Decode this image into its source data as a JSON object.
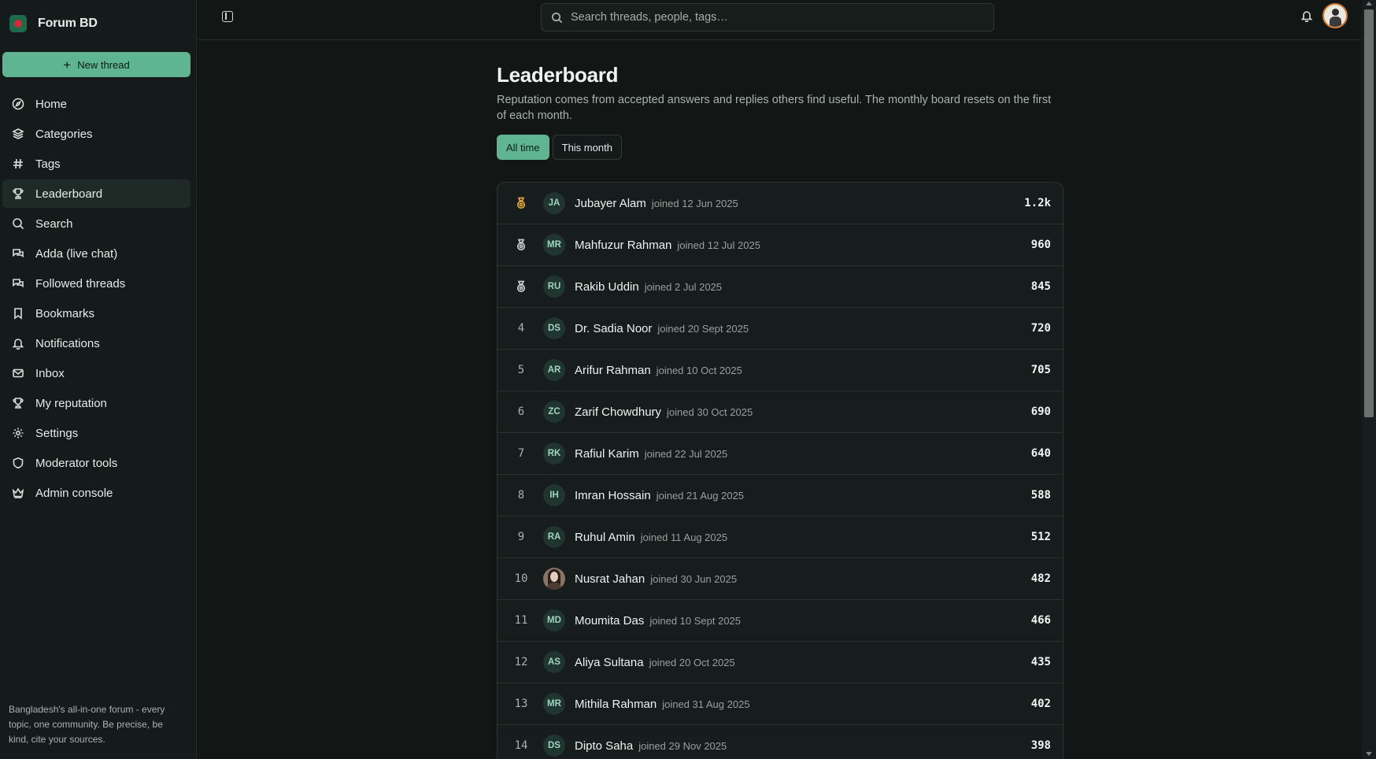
{
  "brand": {
    "name": "Forum BD"
  },
  "sidebar": {
    "new_thread_label": "New thread",
    "items": [
      {
        "label": "Home",
        "icon": "compass-icon"
      },
      {
        "label": "Categories",
        "icon": "layers-icon"
      },
      {
        "label": "Tags",
        "icon": "hash-icon"
      },
      {
        "label": "Leaderboard",
        "icon": "trophy-icon",
        "active": true
      },
      {
        "label": "Search",
        "icon": "search-icon"
      },
      {
        "label": "Adda (live chat)",
        "icon": "chat-icon"
      },
      {
        "label": "Followed threads",
        "icon": "chat-icon"
      },
      {
        "label": "Bookmarks",
        "icon": "bookmark-icon"
      },
      {
        "label": "Notifications",
        "icon": "bell-icon"
      },
      {
        "label": "Inbox",
        "icon": "mail-icon"
      },
      {
        "label": "My reputation",
        "icon": "trophy-icon"
      },
      {
        "label": "Settings",
        "icon": "gear-icon"
      },
      {
        "label": "Moderator tools",
        "icon": "shield-icon"
      },
      {
        "label": "Admin console",
        "icon": "crown-icon"
      }
    ],
    "footer": "Bangladesh's all-in-one forum - every topic, one community. Be precise, be kind, cite your sources."
  },
  "topbar": {
    "search_placeholder": "Search threads, people, tags…"
  },
  "page": {
    "title": "Leaderboard",
    "description": "Reputation comes from accepted answers and replies others find useful. The monthly board resets on the first of each month.",
    "tabs": [
      {
        "label": "All time",
        "active": true
      },
      {
        "label": "This month",
        "active": false
      }
    ]
  },
  "colors": {
    "accent": "#5fb592",
    "gold": "#e0a83a",
    "silver": "#c9cfcd",
    "bronze": "#c9cfcd"
  },
  "leaderboard": [
    {
      "rank": "1",
      "medal": "gold",
      "initials": "JA",
      "name": "Jubayer Alam",
      "joined": "joined 12 Jun 2025",
      "points": "1.2k"
    },
    {
      "rank": "2",
      "medal": "silver",
      "initials": "MR",
      "name": "Mahfuzur Rahman",
      "joined": "joined 12 Jul 2025",
      "points": "960"
    },
    {
      "rank": "3",
      "medal": "bronze",
      "initials": "RU",
      "name": "Rakib Uddin",
      "joined": "joined 2 Jul 2025",
      "points": "845"
    },
    {
      "rank": "4",
      "initials": "DS",
      "name": "Dr. Sadia Noor",
      "joined": "joined 20 Sept 2025",
      "points": "720"
    },
    {
      "rank": "5",
      "initials": "AR",
      "name": "Arifur Rahman",
      "joined": "joined 10 Oct 2025",
      "points": "705"
    },
    {
      "rank": "6",
      "initials": "ZC",
      "name": "Zarif Chowdhury",
      "joined": "joined 30 Oct 2025",
      "points": "690"
    },
    {
      "rank": "7",
      "initials": "RK",
      "name": "Rafiul Karim",
      "joined": "joined 22 Jul 2025",
      "points": "640"
    },
    {
      "rank": "8",
      "initials": "IH",
      "name": "Imran Hossain",
      "joined": "joined 21 Aug 2025",
      "points": "588"
    },
    {
      "rank": "9",
      "initials": "RA",
      "name": "Ruhul Amin",
      "joined": "joined 11 Aug 2025",
      "points": "512"
    },
    {
      "rank": "10",
      "initials": "",
      "photo": true,
      "name": "Nusrat Jahan",
      "joined": "joined 30 Jun 2025",
      "points": "482"
    },
    {
      "rank": "11",
      "initials": "MD",
      "name": "Moumita Das",
      "joined": "joined 10 Sept 2025",
      "points": "466"
    },
    {
      "rank": "12",
      "initials": "AS",
      "name": "Aliya Sultana",
      "joined": "joined 20 Oct 2025",
      "points": "435"
    },
    {
      "rank": "13",
      "initials": "MR",
      "name": "Mithila Rahman",
      "joined": "joined 31 Aug 2025",
      "points": "402"
    },
    {
      "rank": "14",
      "initials": "DS",
      "name": "Dipto Saha",
      "joined": "joined 29 Nov 2025",
      "points": "398"
    }
  ]
}
